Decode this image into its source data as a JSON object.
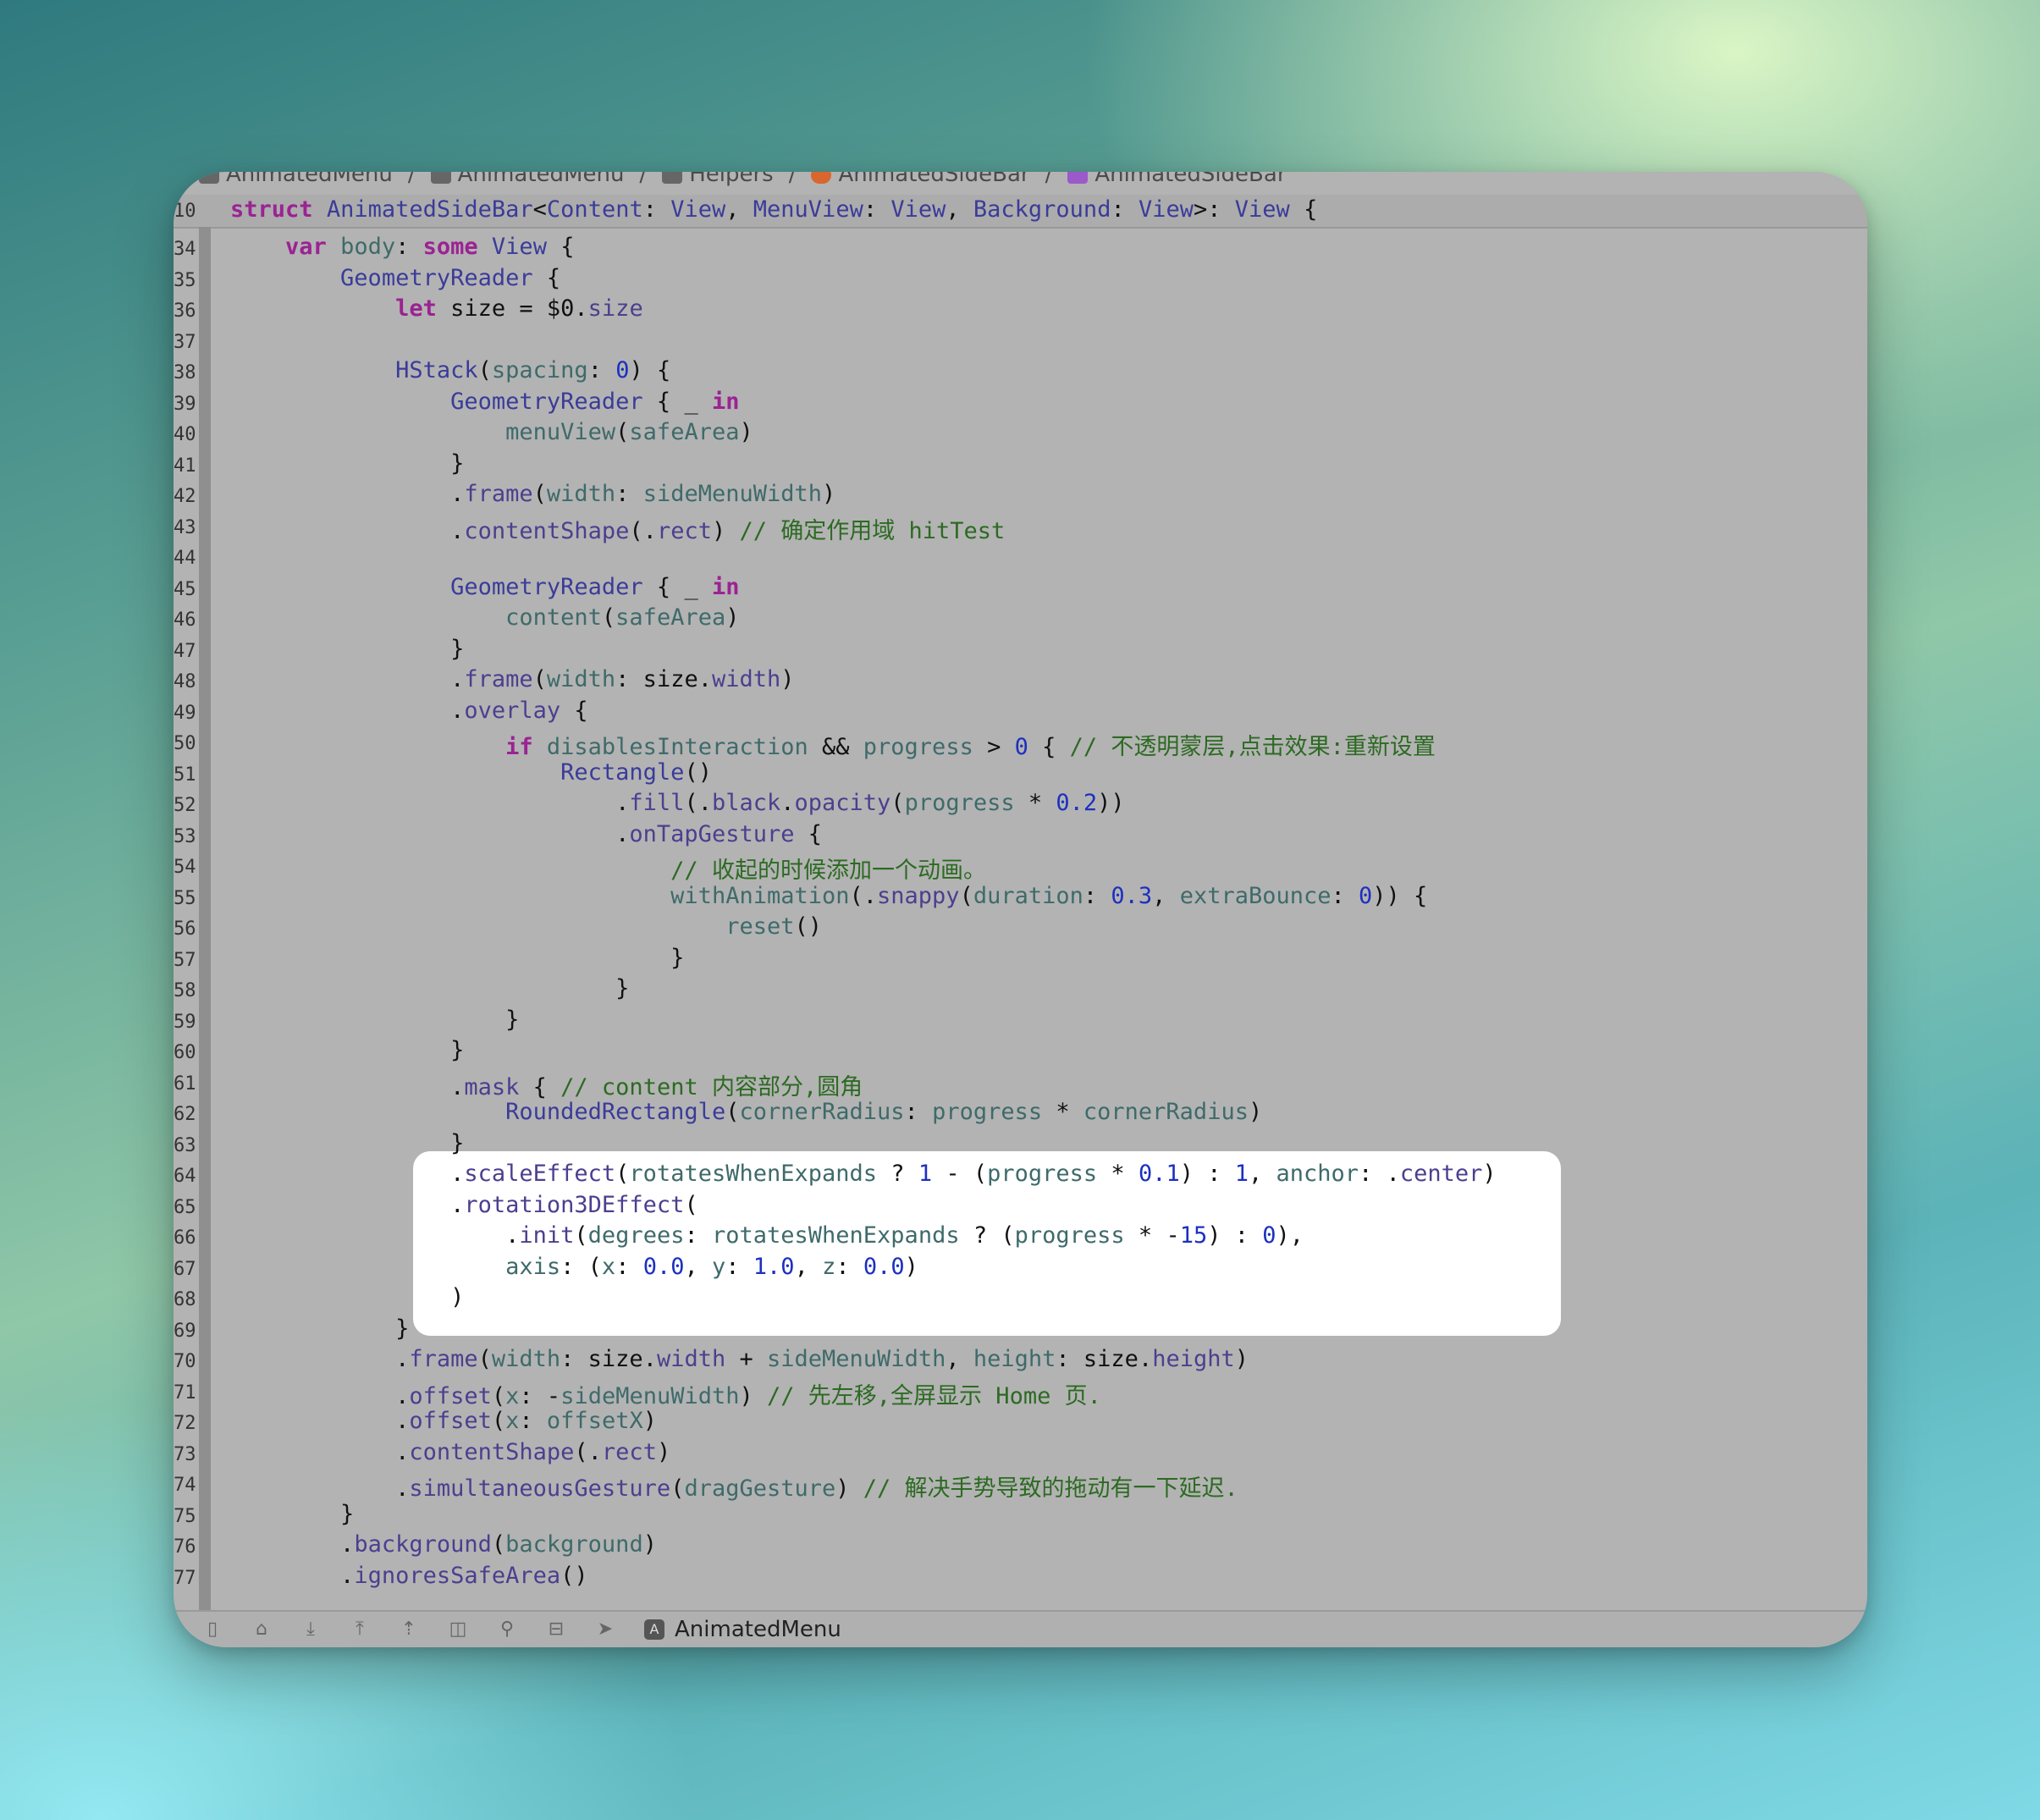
{
  "breadcrumb": {
    "items": [
      {
        "label": "AnimatedMenu",
        "icon": "folder-icon"
      },
      {
        "label": "AnimatedMenu",
        "icon": "folder-icon"
      },
      {
        "label": "Helpers",
        "icon": "folder-icon"
      },
      {
        "label": "AnimatedSideBar",
        "icon": "swift-file-icon"
      },
      {
        "label": "AnimatedSideBar",
        "icon": "struct-icon"
      }
    ]
  },
  "sticky_header": {
    "line_number": "10",
    "text": "struct AnimatedSideBar<Content: View, MenuView: View, Background: View>: View {"
  },
  "lines": [
    {
      "n": "34",
      "code": "    var body: some View {"
    },
    {
      "n": "35",
      "code": "        GeometryReader {"
    },
    {
      "n": "36",
      "code": "            let size = $0.size"
    },
    {
      "n": "37",
      "code": ""
    },
    {
      "n": "38",
      "code": "            HStack(spacing: 0) {"
    },
    {
      "n": "39",
      "code": "                GeometryReader { _ in"
    },
    {
      "n": "40",
      "code": "                    menuView(safeArea)"
    },
    {
      "n": "41",
      "code": "                }"
    },
    {
      "n": "42",
      "code": "                .frame(width: sideMenuWidth)"
    },
    {
      "n": "43",
      "code": "                .contentShape(.rect) // 确定作用域 hitTest"
    },
    {
      "n": "44",
      "code": ""
    },
    {
      "n": "45",
      "code": "                GeometryReader { _ in"
    },
    {
      "n": "46",
      "code": "                    content(safeArea)"
    },
    {
      "n": "47",
      "code": "                }"
    },
    {
      "n": "48",
      "code": "                .frame(width: size.width)"
    },
    {
      "n": "49",
      "code": "                .overlay {"
    },
    {
      "n": "50",
      "code": "                    if disablesInteraction && progress > 0 { // 不透明蒙层,点击效果:重新设置"
    },
    {
      "n": "51",
      "code": "                        Rectangle()"
    },
    {
      "n": "52",
      "code": "                            .fill(.black.opacity(progress * 0.2))"
    },
    {
      "n": "53",
      "code": "                            .onTapGesture {"
    },
    {
      "n": "54",
      "code": "                                // 收起的时候添加一个动画。"
    },
    {
      "n": "55",
      "code": "                                withAnimation(.snappy(duration: 0.3, extraBounce: 0)) {"
    },
    {
      "n": "56",
      "code": "                                    reset()"
    },
    {
      "n": "57",
      "code": "                                }"
    },
    {
      "n": "58",
      "code": "                            }"
    },
    {
      "n": "59",
      "code": "                    }"
    },
    {
      "n": "60",
      "code": "                }"
    },
    {
      "n": "61",
      "code": "                .mask { // content 内容部分,圆角"
    },
    {
      "n": "62",
      "code": "                    RoundedRectangle(cornerRadius: progress * cornerRadius)"
    },
    {
      "n": "63",
      "code": "                }"
    },
    {
      "n": "64",
      "code": "                .scaleEffect(rotatesWhenExpands ? 1 - (progress * 0.1) : 1, anchor: .center)"
    },
    {
      "n": "65",
      "code": "                .rotation3DEffect("
    },
    {
      "n": "66",
      "code": "                    .init(degrees: rotatesWhenExpands ? (progress * -15) : 0),"
    },
    {
      "n": "67",
      "code": "                    axis: (x: 0.0, y: 1.0, z: 0.0)"
    },
    {
      "n": "68",
      "code": "                )"
    },
    {
      "n": "69",
      "code": "            }"
    },
    {
      "n": "70",
      "code": "            .frame(width: size.width + sideMenuWidth, height: size.height)"
    },
    {
      "n": "71",
      "code": "            .offset(x: -sideMenuWidth) // 先左移,全屏显示 Home 页."
    },
    {
      "n": "72",
      "code": "            .offset(x: offsetX)"
    },
    {
      "n": "73",
      "code": "            .contentShape(.rect)"
    },
    {
      "n": "74",
      "code": "            .simultaneousGesture(dragGesture) // 解决手势导致的拖动有一下延迟."
    },
    {
      "n": "75",
      "code": "        }"
    },
    {
      "n": "76",
      "code": "        .background(background)"
    },
    {
      "n": "77",
      "code": "        .ignoresSafeArea()"
    }
  ],
  "statusbar": {
    "icons": [
      "debug-area-icon",
      "breakpoint-icon",
      "step-over-icon",
      "step-in-icon",
      "step-out-icon",
      "view-debugger-icon",
      "memory-graph-icon",
      "environment-icon",
      "location-icon"
    ],
    "scheme_label": "AnimatedMenu"
  },
  "colors": {
    "keyword": "#9b2393",
    "type": "#3b3b9a",
    "number": "#1c30c0",
    "comment": "#2c6a22",
    "editor_background": "#b3b3b3",
    "highlight": "#ffffff"
  }
}
